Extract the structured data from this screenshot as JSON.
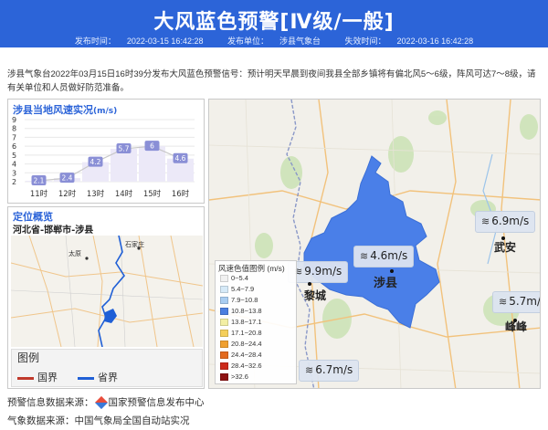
{
  "header": {
    "title": "大风蓝色预警[Ⅳ级/一般]",
    "publish_time_label": "发布时间：",
    "publish_time": "2022-03-15 16:42:28",
    "publisher_label": "发布单位：",
    "publisher": "涉县气象台",
    "expire_label": "失效时间：",
    "expire_time": "2022-03-16 16:42:28"
  },
  "description": "涉县气象台2022年03月15日16时39分发布大风蓝色预警信号：预计明天早晨到夜间我县全部乡镇将有偏北风5～6级，阵风可达7～8级，请有关单位和人员做好防范准备。",
  "chart_panel": {
    "title": "涉县当地风速实况",
    "unit": "(m/s)"
  },
  "chart_data": {
    "type": "line",
    "categories": [
      "11时",
      "12时",
      "13时",
      "14时",
      "15时",
      "16时"
    ],
    "values": [
      2.1,
      2.4,
      4.2,
      5.7,
      6,
      4.6
    ],
    "value_labels": [
      "2.1",
      "2.4",
      "4.2",
      "5.7",
      "6",
      "4.6"
    ],
    "y_ticks": [
      "9",
      "8",
      "7",
      "6",
      "5",
      "4",
      "3",
      "2"
    ],
    "ylim": [
      2,
      9
    ],
    "grid": true,
    "colors": {
      "line": "#c8c8c8",
      "label_bg": "#8a8fd6",
      "bar": "#b7b5e6"
    }
  },
  "location_panel": {
    "title": "定位概览",
    "subtitle": "河北省-邯郸市-涉县",
    "map_labels": {
      "taiyuan": "太原",
      "shijiazhuang": "石家庄"
    },
    "legend_title": "图例",
    "legend_items": [
      {
        "label": "国界",
        "color": "#c0392b"
      },
      {
        "label": "省界",
        "color": "#1f5fd6"
      }
    ]
  },
  "map": {
    "wind_speed_legend_title": "风速色值图例 (m/s)",
    "wind_speed_legend": [
      {
        "label": "0~5.4",
        "color": "#f1f1f1"
      },
      {
        "label": "5.4~7.9",
        "color": "#d6eaf8"
      },
      {
        "label": "7.9~10.8",
        "color": "#a9cdf1"
      },
      {
        "label": "10.8~13.8",
        "color": "#4b7fe0"
      },
      {
        "label": "13.8~17.1",
        "color": "#f3efa4"
      },
      {
        "label": "17.1~20.8",
        "color": "#f5cf5a"
      },
      {
        "label": "20.8~24.4",
        "color": "#f0a030"
      },
      {
        "label": "24.4~28.4",
        "color": "#e36a1f"
      },
      {
        "label": "28.4~32.6",
        "color": "#cc2a1a"
      },
      {
        "label": ">32.6",
        "color": "#8e1212"
      }
    ],
    "wind_labels": [
      {
        "id": "shexian",
        "value": "4.6m/s"
      },
      {
        "id": "licheng",
        "value": "9.9m/s"
      },
      {
        "id": "wuan",
        "value": "6.9m/s"
      },
      {
        "id": "fengfeng",
        "value": "5.7m/s"
      },
      {
        "id": "south",
        "value": "6.7m/s"
      }
    ],
    "cities": {
      "shexian": "涉县",
      "licheng": "黎城",
      "wuan": "武安",
      "fengfeng": "峰峰"
    }
  },
  "footer": {
    "warning_source_label": "预警信息数据来源：",
    "warning_source": "国家预警信息发布中心",
    "weather_source_label": "气象数据来源：",
    "weather_source": "中国气象局全国自动站实况"
  }
}
